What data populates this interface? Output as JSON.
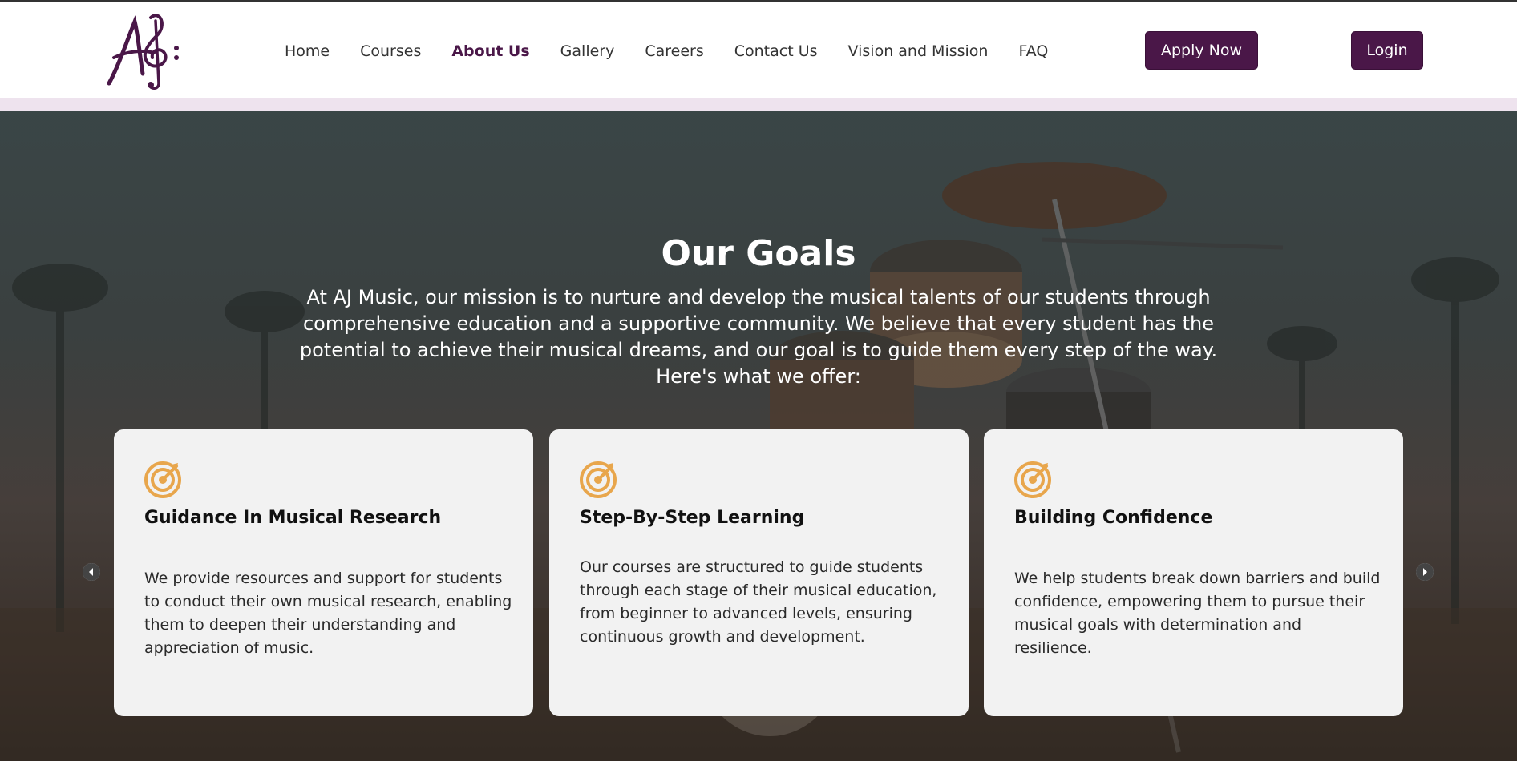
{
  "header": {
    "nav": [
      "Home",
      "Courses",
      "About Us",
      "Gallery",
      "Careers",
      "Contact Us",
      "Vision and Mission",
      "FAQ"
    ],
    "active_nav": "About Us",
    "apply_label": "Apply Now",
    "login_label": "Login",
    "brand_color": "#4a1748"
  },
  "hero": {
    "title": "Our Goals",
    "text": "At AJ Music, our mission is to nurture and develop the musical talents of our students through comprehensive education and a supportive community. We believe that every student has the potential to achieve their musical dreams, and our goal is to guide them every step of the way. Here's what we offer:"
  },
  "cards": [
    {
      "icon": "target-arrow-icon",
      "title": "Guidance In Musical Research",
      "text": "We provide resources and support for students to conduct their own musical research, enabling them to deepen their understanding and appreciation of music."
    },
    {
      "icon": "target-arrow-icon",
      "title": "Step-By-Step Learning",
      "text": "Our courses are structured to guide students through each stage of their musical education, from beginner to advanced levels, ensuring continuous growth and development."
    },
    {
      "icon": "target-arrow-icon",
      "title": "Building Confidence",
      "text": "We help students break down barriers and build confidence, empowering them to pursue their musical goals with determination and resilience."
    }
  ],
  "icon_color": "#e8a64c"
}
